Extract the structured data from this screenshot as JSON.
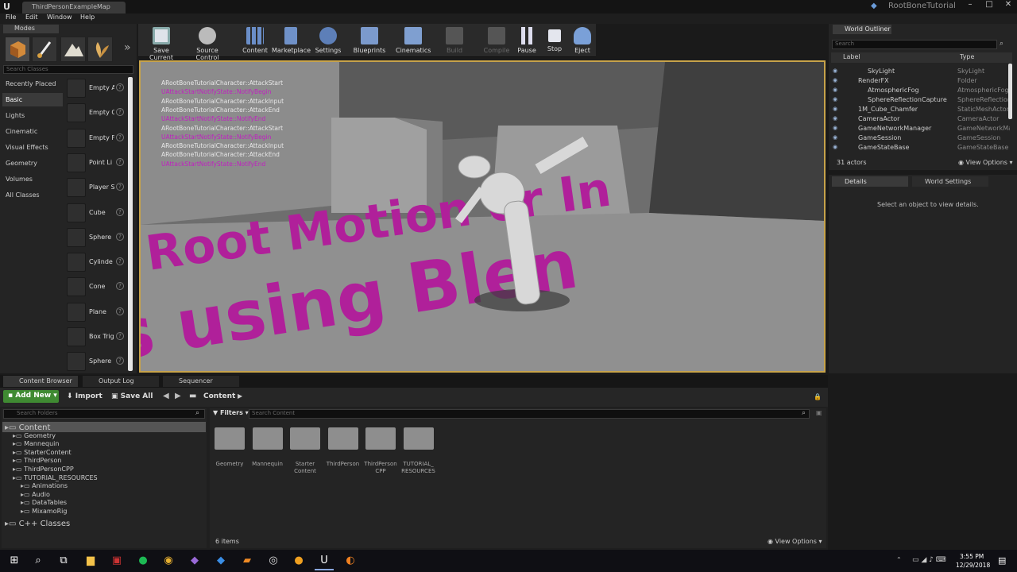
{
  "window": {
    "map_tab": "ThirdPersonExampleMap",
    "project_name": "RootBoneTutorial",
    "min": "–",
    "max": "□",
    "close": "✕"
  },
  "menu": [
    "File",
    "Edit",
    "Window",
    "Help"
  ],
  "modes": {
    "tab": "Modes",
    "search_placeholder": "Search Classes",
    "categories": [
      "Recently Placed",
      "Basic",
      "Lights",
      "Cinematic",
      "Visual Effects",
      "Geometry",
      "Volumes",
      "All Classes"
    ],
    "items": [
      "Empty A",
      "Empty C",
      "Empty F",
      "Point Li",
      "Player S",
      "Cube",
      "Sphere",
      "Cylinde",
      "Cone",
      "Plane",
      "Box Trig",
      "Sphere"
    ]
  },
  "toolbar": {
    "items": [
      "Save Current",
      "Source Control",
      "Content",
      "Marketplace",
      "Settings",
      "Blueprints",
      "Cinematics",
      "Build",
      "Compile",
      "Pause",
      "Stop",
      "Eject"
    ]
  },
  "viewport": {
    "log": [
      {
        "text": "ARootBoneTutorialCharacter::AttackStart",
        "color": "#e8e8e8"
      },
      {
        "text": "UAttackStartNotifyState::NotifyBegin",
        "color": "#c020c0"
      },
      {
        "text": "ARootBoneTutorialCharacter::AttackInput",
        "color": "#e8e8e8"
      },
      {
        "text": "ARootBoneTutorialCharacter::AttackEnd",
        "color": "#e8e8e8"
      },
      {
        "text": "UAttackStartNotifyState::NotifyEnd",
        "color": "#c020c0"
      },
      {
        "text": "ARootBoneTutorialCharacter::AttackStart",
        "color": "#e8e8e8"
      },
      {
        "text": "UAttackStartNotifyState::NotifyBegin",
        "color": "#c020c0"
      },
      {
        "text": "ARootBoneTutorialCharacter::AttackInput",
        "color": "#e8e8e8"
      },
      {
        "text": "ARootBoneTutorialCharacter::AttackEnd",
        "color": "#e8e8e8"
      },
      {
        "text": "UAttackStartNotifyState::NotifyEnd",
        "color": "#c020c0"
      }
    ],
    "floor_text_1": "Root Motion or In",
    "floor_text_2": "s using Blen"
  },
  "outliner": {
    "tab": "World Outliner",
    "search_placeholder": "Search",
    "col_label": "Label",
    "col_type": "Type",
    "rows": [
      {
        "label": "SkyLight",
        "type": "SkyLight",
        "indent": 2
      },
      {
        "label": "RenderFX",
        "type": "Folder",
        "indent": 1
      },
      {
        "label": "AtmosphericFog",
        "type": "AtmosphericFog",
        "indent": 2
      },
      {
        "label": "SphereReflectionCapture",
        "type": "SphereReflection",
        "indent": 2
      },
      {
        "label": "1M_Cube_Chamfer",
        "type": "StaticMeshActor",
        "indent": 1
      },
      {
        "label": "CameraActor",
        "type": "CameraActor",
        "indent": 1
      },
      {
        "label": "GameNetworkManager",
        "type": "GameNetworkMa",
        "indent": 1
      },
      {
        "label": "GameSession",
        "type": "GameSession",
        "indent": 1
      },
      {
        "label": "GameStateBase",
        "type": "GameStateBase",
        "indent": 1
      }
    ],
    "count": "31 actors",
    "view_options": "View Options"
  },
  "details": {
    "tab": "Details",
    "tab2": "World Settings",
    "empty_msg": "Select an object to view details."
  },
  "content_browser": {
    "tabs": [
      "Content Browser",
      "Output Log",
      "Sequencer"
    ],
    "add_new": "Add New",
    "import": "Import",
    "save_all": "Save All",
    "path": "Content",
    "search_folders": "Search Folders",
    "filters": "Filters",
    "search_content": "Search Content",
    "tree": [
      {
        "label": "Content",
        "indent": 0
      },
      {
        "label": "Geometry",
        "indent": 1
      },
      {
        "label": "Mannequin",
        "indent": 1
      },
      {
        "label": "StarterContent",
        "indent": 1
      },
      {
        "label": "ThirdPerson",
        "indent": 1
      },
      {
        "label": "ThirdPersonCPP",
        "indent": 1
      },
      {
        "label": "TUTORIAL_RESOURCES",
        "indent": 1
      },
      {
        "label": "Animations",
        "indent": 2
      },
      {
        "label": "Audio",
        "indent": 2
      },
      {
        "label": "DataTables",
        "indent": 2
      },
      {
        "label": "MixamoRig",
        "indent": 2
      },
      {
        "label": "C++ Classes",
        "indent": 0
      }
    ],
    "assets": [
      "Geometry",
      "Mannequin",
      "Starter Content",
      "ThirdPerson",
      "ThirdPerson CPP",
      "TUTORIAL_ RESOURCES"
    ],
    "item_count": "6 items",
    "view_options": "View Options"
  },
  "taskbar": {
    "time": "3:55 PM",
    "date": "12/29/2018"
  }
}
